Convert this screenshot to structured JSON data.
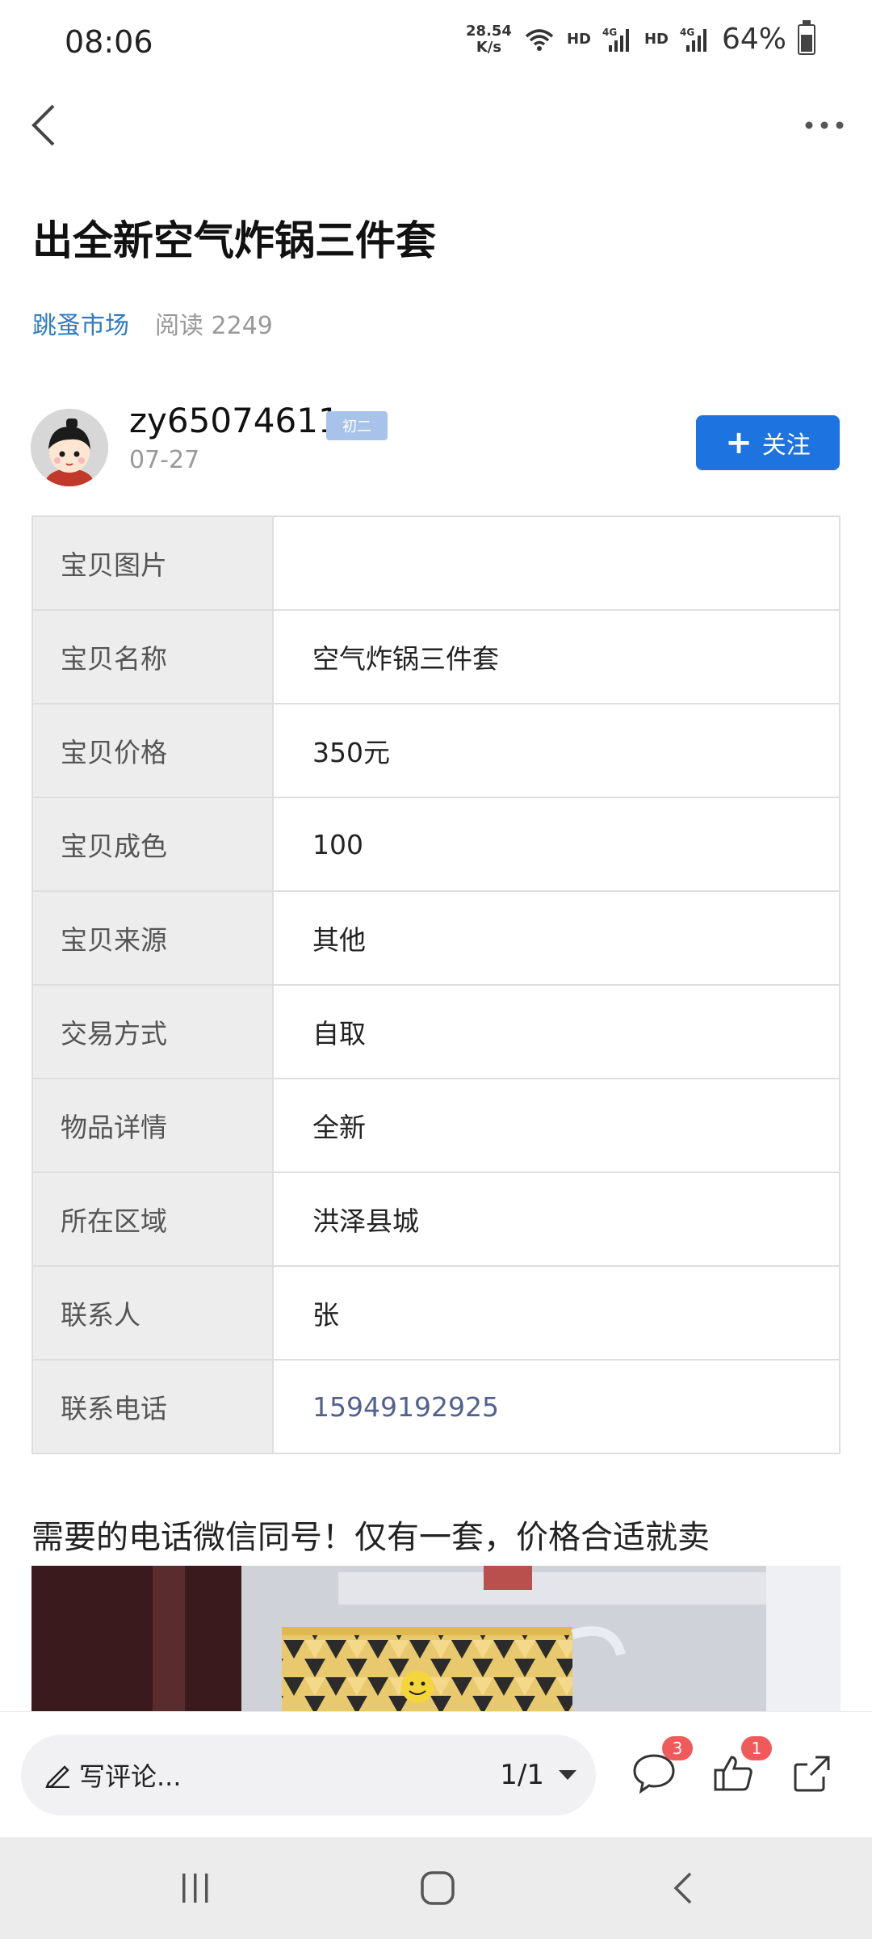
{
  "status_bar": {
    "time": "08:06",
    "net_speed_value": "28.54",
    "net_speed_unit": "K/s",
    "hd1": "HD",
    "hd2": "HD",
    "battery": "64%"
  },
  "post": {
    "title": "出全新空气炸锅三件套",
    "category": "跳蚤市场",
    "reads": "阅读 2249"
  },
  "author": {
    "name": "zy65074611",
    "level": "初二",
    "date": "07-27",
    "follow_label": "关注"
  },
  "table": [
    {
      "label": "宝贝图片",
      "value": ""
    },
    {
      "label": "宝贝名称",
      "value": "空气炸锅三件套"
    },
    {
      "label": "宝贝价格",
      "value": "350元"
    },
    {
      "label": "宝贝成色",
      "value": "100"
    },
    {
      "label": "宝贝来源",
      "value": "其他"
    },
    {
      "label": "交易方式",
      "value": "自取"
    },
    {
      "label": "物品详情",
      "value": "全新"
    },
    {
      "label": "所在区域",
      "value": "洪泽县城"
    },
    {
      "label": "联系人",
      "value": "张"
    },
    {
      "label": "联系电话",
      "value": "15949192925"
    }
  ],
  "description": "需要的电话微信同号！仅有一套，价格合适就卖",
  "bottom_bar": {
    "comment_placeholder": "写评论...",
    "page_indicator": "1/1",
    "comment_count": "3",
    "like_count": "1"
  },
  "colors": {
    "accent": "#1d73e0",
    "link": "#2f7bc0",
    "phone": "#52628e",
    "badge": "#f05a5a"
  }
}
